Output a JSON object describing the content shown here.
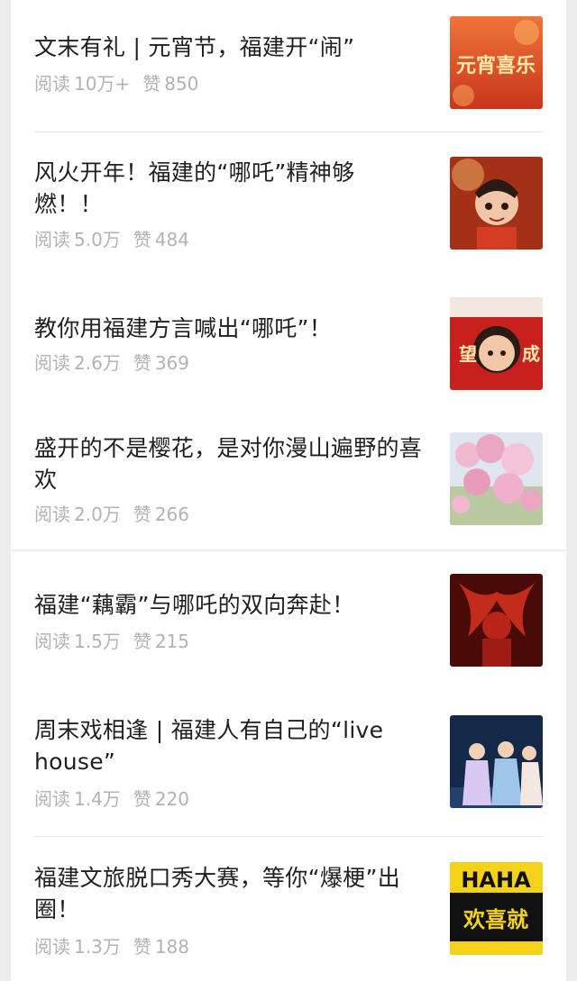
{
  "labels": {
    "reads": "阅读",
    "likes": "赞"
  },
  "articles": [
    {
      "title": "文末有礼 | 元宵节，福建开“闹”",
      "reads": "10万+",
      "likes": "850",
      "thumb_icon": "lantern-festival-icon",
      "thumb_text": "元宵喜乐"
    },
    {
      "title": "风火开年！福建的“哪吒”精神够燃！！",
      "reads": "5.0万",
      "likes": "484",
      "thumb_icon": "nezha-cartoon-icon"
    },
    {
      "title": "教你用福建方言喊出“哪吒”！",
      "reads": "2.6万",
      "likes": "369",
      "thumb_icon": "nezha-dialect-icon",
      "thumb_text_left": "望",
      "thumb_text_right": "成"
    },
    {
      "title": "盛开的不是樱花，是对你漫山遍野的喜欢",
      "reads": "2.0万",
      "likes": "266",
      "thumb_icon": "cherry-blossom-icon"
    },
    {
      "title": "福建“藕霸”与哪吒的双向奔赴！",
      "reads": "1.5万",
      "likes": "215",
      "thumb_icon": "red-figure-icon"
    },
    {
      "title": "周末戏相逢 | 福建人有自己的“live house”",
      "reads": "1.4万",
      "likes": "220",
      "thumb_icon": "opera-stage-icon"
    },
    {
      "title": "福建文旅脱口秀大赛，等你“爆梗”出圈！",
      "reads": "1.3万",
      "likes": "188",
      "thumb_icon": "talk-show-poster-icon",
      "thumb_text": "HAHA",
      "thumb_text_2": "欢喜就"
    }
  ]
}
